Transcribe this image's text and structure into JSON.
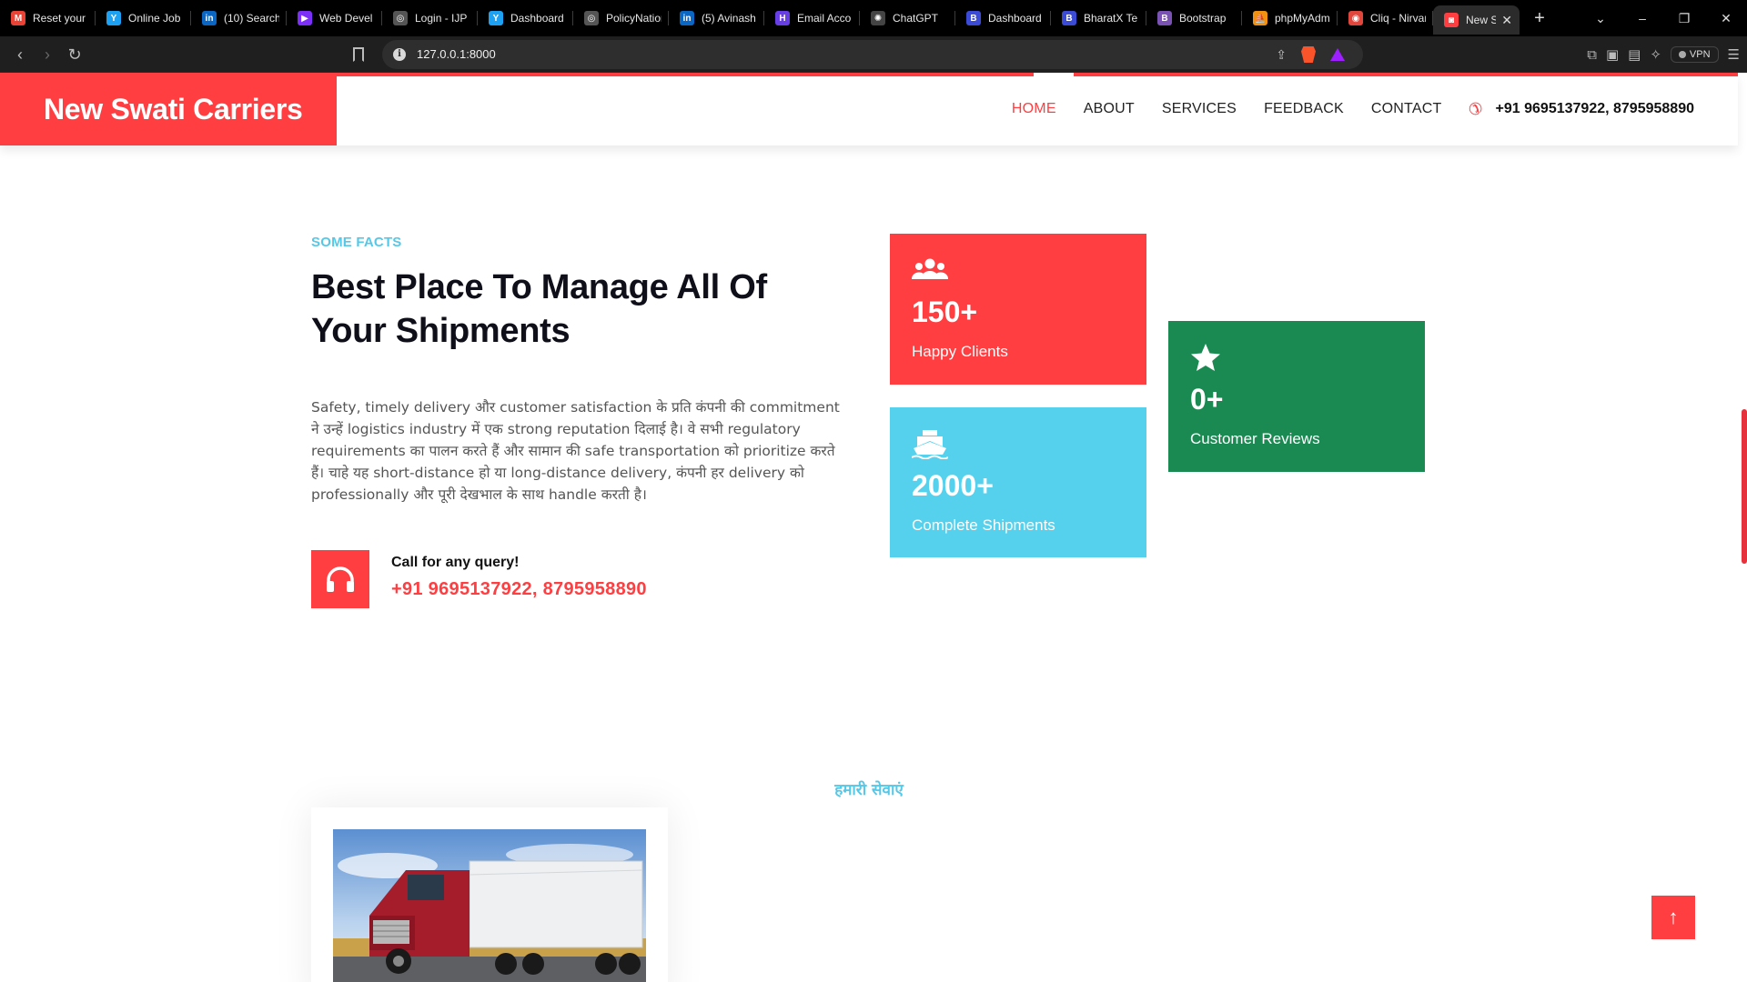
{
  "browser": {
    "tabs": [
      {
        "title": "Reset your",
        "icon": "gmail-icon",
        "color": "#ea4335",
        "glyph": "M"
      },
      {
        "title": "Online Job",
        "icon": "y-logo-icon",
        "color": "#1da1f2",
        "glyph": "Y"
      },
      {
        "title": "(10) Search",
        "icon": "linkedin-icon",
        "color": "#0a66c2",
        "glyph": "in"
      },
      {
        "title": "Web Devel",
        "icon": "play-arrow-icon",
        "color": "#7b2ff7",
        "glyph": "▶"
      },
      {
        "title": "Login - IJP",
        "icon": "globe-icon",
        "color": "#555555",
        "glyph": "◎"
      },
      {
        "title": "Dashboard",
        "icon": "y-logo-icon",
        "color": "#1da1f2",
        "glyph": "Y"
      },
      {
        "title": "PolicyNation",
        "icon": "globe-icon",
        "color": "#555555",
        "glyph": "◎"
      },
      {
        "title": "(5) Avinash",
        "icon": "linkedin-icon",
        "color": "#0a66c2",
        "glyph": "in"
      },
      {
        "title": "Email Acco",
        "icon": "hostinger-icon",
        "color": "#673de6",
        "glyph": "H"
      },
      {
        "title": "ChatGPT",
        "icon": "chatgpt-icon",
        "color": "#444444",
        "glyph": "✺"
      },
      {
        "title": "Dashboard",
        "icon": "bootstrap-icon",
        "color": "#3c4bd6",
        "glyph": "B"
      },
      {
        "title": "BharatX Te",
        "icon": "bootstrap-icon",
        "color": "#3c4bd6",
        "glyph": "B"
      },
      {
        "title": "Bootstrap",
        "icon": "bootstrap-icon",
        "color": "#7952b3",
        "glyph": "B"
      },
      {
        "title": "phpMyAdmin",
        "icon": "phpmyadmin-icon",
        "color": "#f29111",
        "glyph": "⛵"
      },
      {
        "title": "Cliq - Nirvana",
        "icon": "cliq-icon",
        "color": "#e0463c",
        "glyph": "◉"
      },
      {
        "title": "New S",
        "icon": "site-favicon-icon",
        "color": "#ff3e41",
        "glyph": "◙"
      }
    ],
    "url": "127.0.0.1:8000",
    "vpn_label": "VPN"
  },
  "site": {
    "brand": "New Swati Carriers",
    "nav": [
      {
        "label": "HOME",
        "active": true
      },
      {
        "label": "ABOUT",
        "active": false
      },
      {
        "label": "SERVICES",
        "active": false
      },
      {
        "label": "FEEDBACK",
        "active": false
      },
      {
        "label": "CONTACT",
        "active": false
      }
    ],
    "phone": "+91 9695137922, 8795958890"
  },
  "facts": {
    "label": "SOME FACTS",
    "heading": "Best Place To Manage All Of Your Shipments",
    "body": "Safety, timely delivery और customer satisfaction के प्रति कंपनी की commitment ने उन्हें logistics industry में एक strong reputation दिलाई है। वे सभी regulatory requirements का पालन करते हैं और सामान की safe transportation को prioritize करते हैं। चाहे यह short-distance हो या long-distance delivery, कंपनी हर delivery को professionally और पूरी देखभाल के साथ handle करती है।",
    "call_label": "Call for any query!",
    "call_number": "+91 9695137922, 8795958890"
  },
  "stats": {
    "clients": {
      "value": "150+",
      "label": "Happy Clients"
    },
    "shipments": {
      "value": "2000+",
      "label": "Complete Shipments"
    },
    "reviews": {
      "value": "0+",
      "label": "Customer Reviews"
    }
  },
  "services": {
    "label": "हमारी सेवाएं"
  },
  "colors": {
    "brand_red": "#ff3e41",
    "accent_cyan": "#55c8e8",
    "green": "#1a8a52"
  }
}
